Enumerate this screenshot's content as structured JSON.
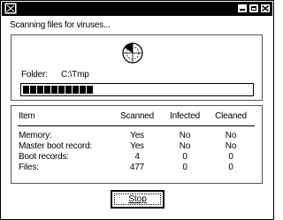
{
  "window": {
    "title": "",
    "controls": [
      "minimize-icon",
      "maximize-icon",
      "close-icon"
    ]
  },
  "status_text": "Scanning files for viruses...",
  "scan_icon": "virus-scanner-icon",
  "folder": {
    "label": "Folder:",
    "value": "C:\\Tmp"
  },
  "progress": {
    "blocks_filled": 10,
    "fraction": 0.27
  },
  "table": {
    "headers": {
      "item": "Item",
      "scanned": "Scanned",
      "infected": "Infected",
      "cleaned": "Cleaned"
    },
    "rows": [
      {
        "item": "Memory:",
        "scanned": "Yes",
        "infected": "No",
        "cleaned": "No"
      },
      {
        "item": "Master boot record:",
        "scanned": "Yes",
        "infected": "No",
        "cleaned": "No"
      },
      {
        "item": "Boot records:",
        "scanned": "4",
        "infected": "0",
        "cleaned": "0"
      },
      {
        "item": "Files:",
        "scanned": "477",
        "infected": "0",
        "cleaned": "0"
      }
    ]
  },
  "buttons": {
    "stop_label": "Stop"
  }
}
